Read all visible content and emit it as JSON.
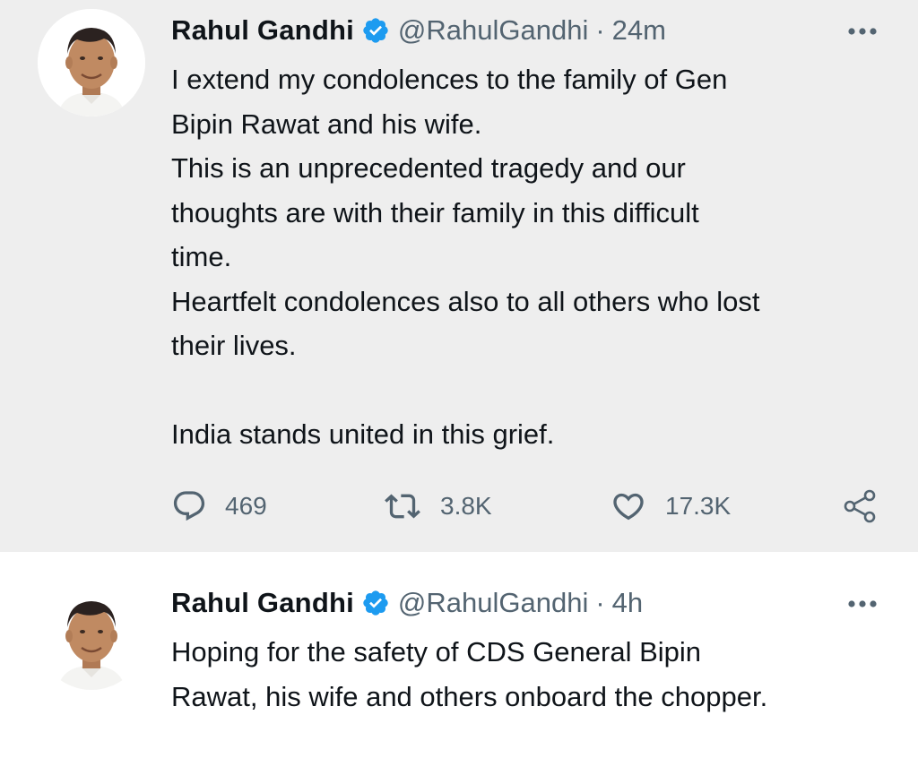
{
  "colors": {
    "verified_blue": "#1d9bf0",
    "muted_text": "#536471",
    "highlight_background": "#eeeeee"
  },
  "tweets": [
    {
      "author_name": "Rahul Gandhi",
      "verified": true,
      "handle": "@RahulGandhi",
      "separator": "·",
      "time": "24m",
      "text_lines": [
        "I extend my condolences to the family of Gen",
        "Bipin Rawat and his wife.",
        "This is an unprecedented tragedy and our",
        "thoughts are with their family in this difficult",
        "time.",
        "Heartfelt condolences also to all others who lost",
        "their lives.",
        "",
        "India stands united in this grief."
      ],
      "actions": {
        "reply_count": "469",
        "retweet_count": "3.8K",
        "like_count": "17.3K"
      },
      "icons": [
        "verified-badge-icon",
        "more-options-icon",
        "reply-icon",
        "retweet-icon",
        "like-icon",
        "share-icon"
      ]
    },
    {
      "author_name": "Rahul Gandhi",
      "verified": true,
      "handle": "@RahulGandhi",
      "separator": "·",
      "time": "4h",
      "text_lines": [
        "Hoping for the safety of CDS General Bipin",
        "Rawat, his wife and others onboard the chopper."
      ],
      "icons": [
        "verified-badge-icon",
        "more-options-icon"
      ]
    }
  ]
}
